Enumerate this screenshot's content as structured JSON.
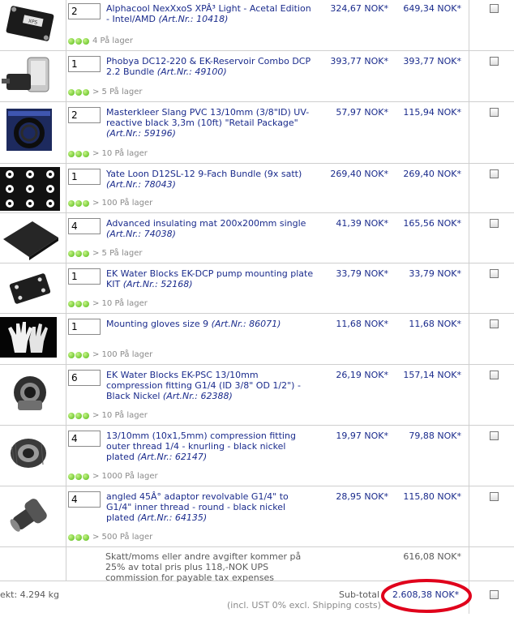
{
  "items": [
    {
      "qty": "2",
      "name": "Alphacool NexXxoS XPÂ³ Light - Acetal Edition - Intel/AMD",
      "art_label": "(Art.Nr.: 10418)",
      "stock": "4 På lager",
      "unit": "324,67 NOK*",
      "total": "649,34 NOK*",
      "icon": "cpu-waterblock-icon"
    },
    {
      "qty": "1",
      "name": "Phobya DC12-220 & EK-Reservoir Combo DCP 2.2 Bundle",
      "art_label": "(Art.Nr.: 49100)",
      "stock": "> 5 På lager",
      "unit": "393,77 NOK*",
      "total": "393,77 NOK*",
      "icon": "pump-reservoir-icon"
    },
    {
      "qty": "2",
      "name": "Masterkleer Slang PVC 13/10mm (3/8\"ID) UV-reactive black 3,3m (10ft) \"Retail Package\"",
      "art_label": "(Art.Nr.: 59196)",
      "stock": "> 10 På lager",
      "unit": "57,97 NOK*",
      "total": "115,94 NOK*",
      "icon": "tubing-package-icon"
    },
    {
      "qty": "1",
      "name": "Yate Loon D12SL-12 9-Fach Bundle (9x satt)",
      "art_label": "(Art.Nr.: 78043)",
      "stock": "> 100 På lager",
      "unit": "269,40 NOK*",
      "total": "269,40 NOK*",
      "icon": "fan-bundle-icon"
    },
    {
      "qty": "4",
      "name": "Advanced insulating mat 200x200mm single",
      "art_label": "(Art.Nr.: 74038)",
      "stock": "> 5 På lager",
      "unit": "41,39 NOK*",
      "total": "165,56 NOK*",
      "icon": "insulating-mat-icon"
    },
    {
      "qty": "1",
      "name": "EK Water Blocks EK-DCP pump mounting plate KIT",
      "art_label": "(Art.Nr.: 52168)",
      "stock": "> 10 På lager",
      "unit": "33,79 NOK*",
      "total": "33,79 NOK*",
      "icon": "mounting-plate-icon"
    },
    {
      "qty": "1",
      "name": "Mounting gloves size 9",
      "art_label": "(Art.Nr.: 86071)",
      "stock": "> 100 På lager",
      "unit": "11,68 NOK*",
      "total": "11,68 NOK*",
      "icon": "gloves-icon"
    },
    {
      "qty": "6",
      "name": "EK Water Blocks EK-PSC 13/10mm compression fitting G1/4 (ID 3/8\" OD 1/2\") - Black Nickel",
      "art_label": "(Art.Nr.: 62388)",
      "stock": "> 10 På lager",
      "unit": "26,19 NOK*",
      "total": "157,14 NOK*",
      "icon": "compression-fitting-icon"
    },
    {
      "qty": "4",
      "name": "13/10mm (10x1,5mm) compression fitting outer thread 1/4 - knurling - black nickel plated",
      "art_label": "(Art.Nr.: 62147)",
      "stock": "> 1000 På lager",
      "unit": "19,97 NOK*",
      "total": "79,88 NOK*",
      "icon": "knurled-fitting-icon"
    },
    {
      "qty": "4",
      "name": "angled 45Â° adaptor revolvable G1/4\" to G1/4\" inner thread - round - black nickel plated",
      "art_label": "(Art.Nr.: 64135)",
      "stock": "> 500 På lager",
      "unit": "28,95 NOK*",
      "total": "115,80 NOK*",
      "icon": "angled-adaptor-icon"
    }
  ],
  "tax": {
    "text": "Skatt/moms eller andre avgifter kommer på 25% av total pris plus 118,-NOK UPS commission for payable tax expenses",
    "amount": "616,08 NOK*"
  },
  "footer": {
    "weight": "ekt: 4.294 kg",
    "subtotal_label": "Sub-total",
    "subtotal_value": "2.608,38 NOK*",
    "note": "(incl. UST 0% excl. Shipping costs)"
  },
  "colors": {
    "link": "#1a2b8c",
    "stock_green": "#52b813",
    "highlight_ring": "#e0001b",
    "border": "#cfcfcf"
  }
}
